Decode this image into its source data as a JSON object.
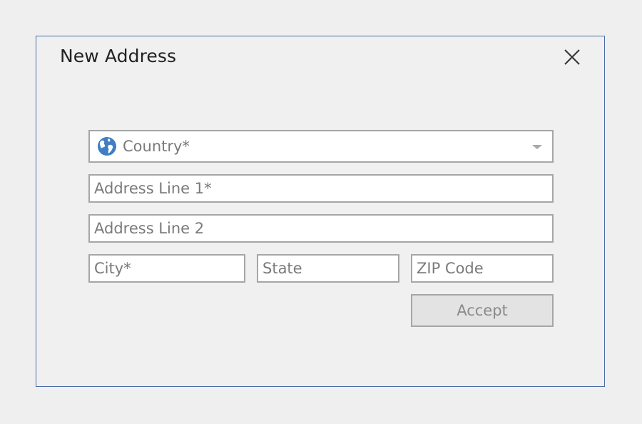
{
  "dialog": {
    "title": "New Address",
    "close_icon": "close-icon"
  },
  "form": {
    "country": {
      "placeholder": "Country*",
      "icon": "globe-icon",
      "dropdown_icon": "chevron-down-icon"
    },
    "address_line_1": {
      "placeholder": "Address Line 1*"
    },
    "address_line_2": {
      "placeholder": "Address Line 2"
    },
    "city": {
      "placeholder": "City*"
    },
    "state": {
      "placeholder": "State"
    },
    "zip": {
      "placeholder": "ZIP Code"
    },
    "accept_label": "Accept"
  },
  "colors": {
    "dialog_border": "#4a6ba6",
    "globe_blue": "#3f7ec3",
    "field_border": "#a6a6a6",
    "placeholder_text": "#7a7a7a"
  }
}
